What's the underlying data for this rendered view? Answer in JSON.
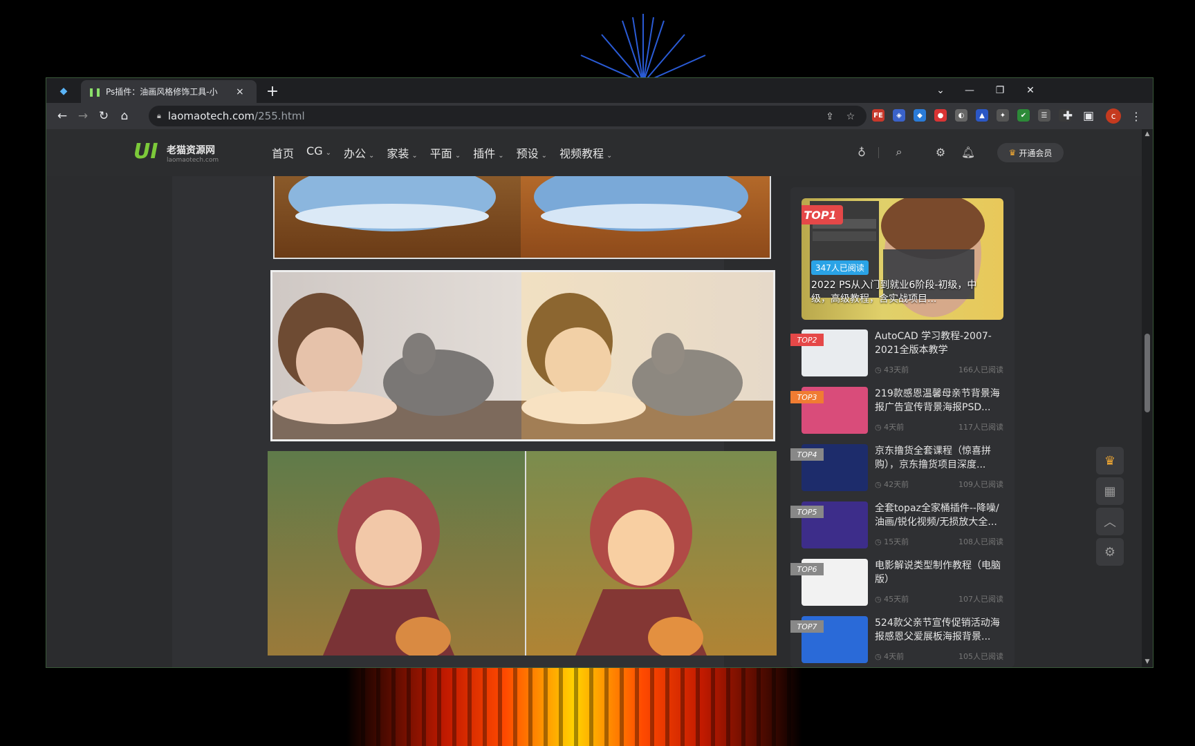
{
  "browser": {
    "tab_title": "Ps插件：油画风格修饰工具-小",
    "tab_close": "×",
    "new_tab": "+",
    "url_host": "laomaotech.com",
    "url_path": "/255.html",
    "profile_initial": "c",
    "extensions": [
      {
        "name": "fe-extension",
        "text": "FE",
        "color": "#c8382b"
      },
      {
        "name": "shield-extension",
        "text": "◈",
        "color": "#3a62c9"
      },
      {
        "name": "diamond-extension",
        "text": "◆",
        "color": "#2a7bd8"
      },
      {
        "name": "record-extension",
        "text": "●",
        "color": "#d93434"
      },
      {
        "name": "swirl-extension",
        "text": "◐",
        "color": "#666"
      },
      {
        "name": "drop-extension",
        "text": "▲",
        "color": "#2b57c5"
      },
      {
        "name": "pin-extension",
        "text": "✦",
        "color": "#555"
      },
      {
        "name": "check-extension",
        "text": "✔",
        "color": "#2c8a38"
      },
      {
        "name": "list-extension",
        "text": "☰",
        "color": "#555"
      },
      {
        "name": "dim-extension",
        "text": "·",
        "color": "#3a3a3a"
      }
    ]
  },
  "site": {
    "logo_mark": "UI",
    "logo_text": "老猫资源网",
    "logo_sub": "laomaotech.com",
    "nav": [
      {
        "label": "首页",
        "has_caret": false
      },
      {
        "label": "CG",
        "has_caret": true
      },
      {
        "label": "办公",
        "has_caret": true
      },
      {
        "label": "家装",
        "has_caret": true
      },
      {
        "label": "平面",
        "has_caret": true
      },
      {
        "label": "插件",
        "has_caret": true
      },
      {
        "label": "预设",
        "has_caret": true
      },
      {
        "label": "视频教程",
        "has_caret": true
      }
    ],
    "vip_label": "开通会员"
  },
  "sidebar": {
    "top1": {
      "badge": "TOP1",
      "reads_badge": "347人已阅读",
      "title": "2022 PS从入门到就业6阶段-初级，中级，高级教程，含实战项目..."
    },
    "items": [
      {
        "badge": "TOP2",
        "badge_color": "#e54848",
        "title": "AutoCAD 学习教程-2007-2021全版本教学",
        "time": "◷ 43天前",
        "reads": "166人已阅读",
        "thumb_color": "#e9ecef"
      },
      {
        "badge": "TOP3",
        "badge_color": "#f07c32",
        "title": "219款感恩温馨母亲节背景海报广告宣传背景海报PSD...",
        "time": "◷ 4天前",
        "reads": "117人已阅读",
        "thumb_color": "#d94c7a"
      },
      {
        "badge": "TOP4",
        "badge_color": "#888",
        "title": "京东撸货全套课程（惊喜拼购），京东撸货项目深度...",
        "time": "◷ 42天前",
        "reads": "109人已阅读",
        "thumb_color": "#1d2c6b"
      },
      {
        "badge": "TOP5",
        "badge_color": "#888",
        "title": "全套topaz全家桶插件--降噪/油画/锐化视频/无损放大全...",
        "time": "◷ 15天前",
        "reads": "108人已阅读",
        "thumb_color": "#3d2d8a"
      },
      {
        "badge": "TOP6",
        "badge_color": "#888",
        "title": "电影解说类型制作教程（电脑版）",
        "time": "◷ 45天前",
        "reads": "107人已阅读",
        "thumb_color": "#f2f2f2"
      },
      {
        "badge": "TOP7",
        "badge_color": "#888",
        "title": "524款父亲节宣传促销活动海报感恩父爱展板海报背景...",
        "time": "◷ 4天前",
        "reads": "105人已阅读",
        "thumb_color": "#2a6ad8"
      }
    ]
  }
}
